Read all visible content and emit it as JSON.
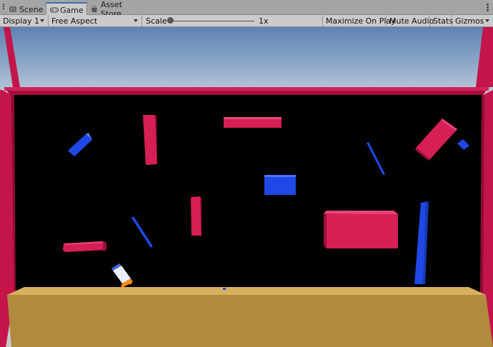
{
  "tabs": [
    {
      "label": "Scene",
      "icon": "scene-icon",
      "active": false
    },
    {
      "label": "Game",
      "icon": "game-controller-icon",
      "active": true
    },
    {
      "label": "Asset Store",
      "icon": "asset-store-icon",
      "active": false
    }
  ],
  "toolbar": {
    "display_label": "Display 1",
    "aspect_label": "Free Aspect",
    "scale_label": "Scale",
    "scale_value": "1x",
    "scale_fraction": 0.0,
    "maximize_label": "Maximize On Play",
    "mute_label": "Mute Audio",
    "stats_label": "Stats",
    "gizmos_label": "Gizmos"
  },
  "colors": {
    "obstacle_red": "#d61f55",
    "obstacle_blue": "#1f48e6",
    "frame_red": "#c3154a",
    "floor": "#b08a3e",
    "background": "#000000"
  }
}
